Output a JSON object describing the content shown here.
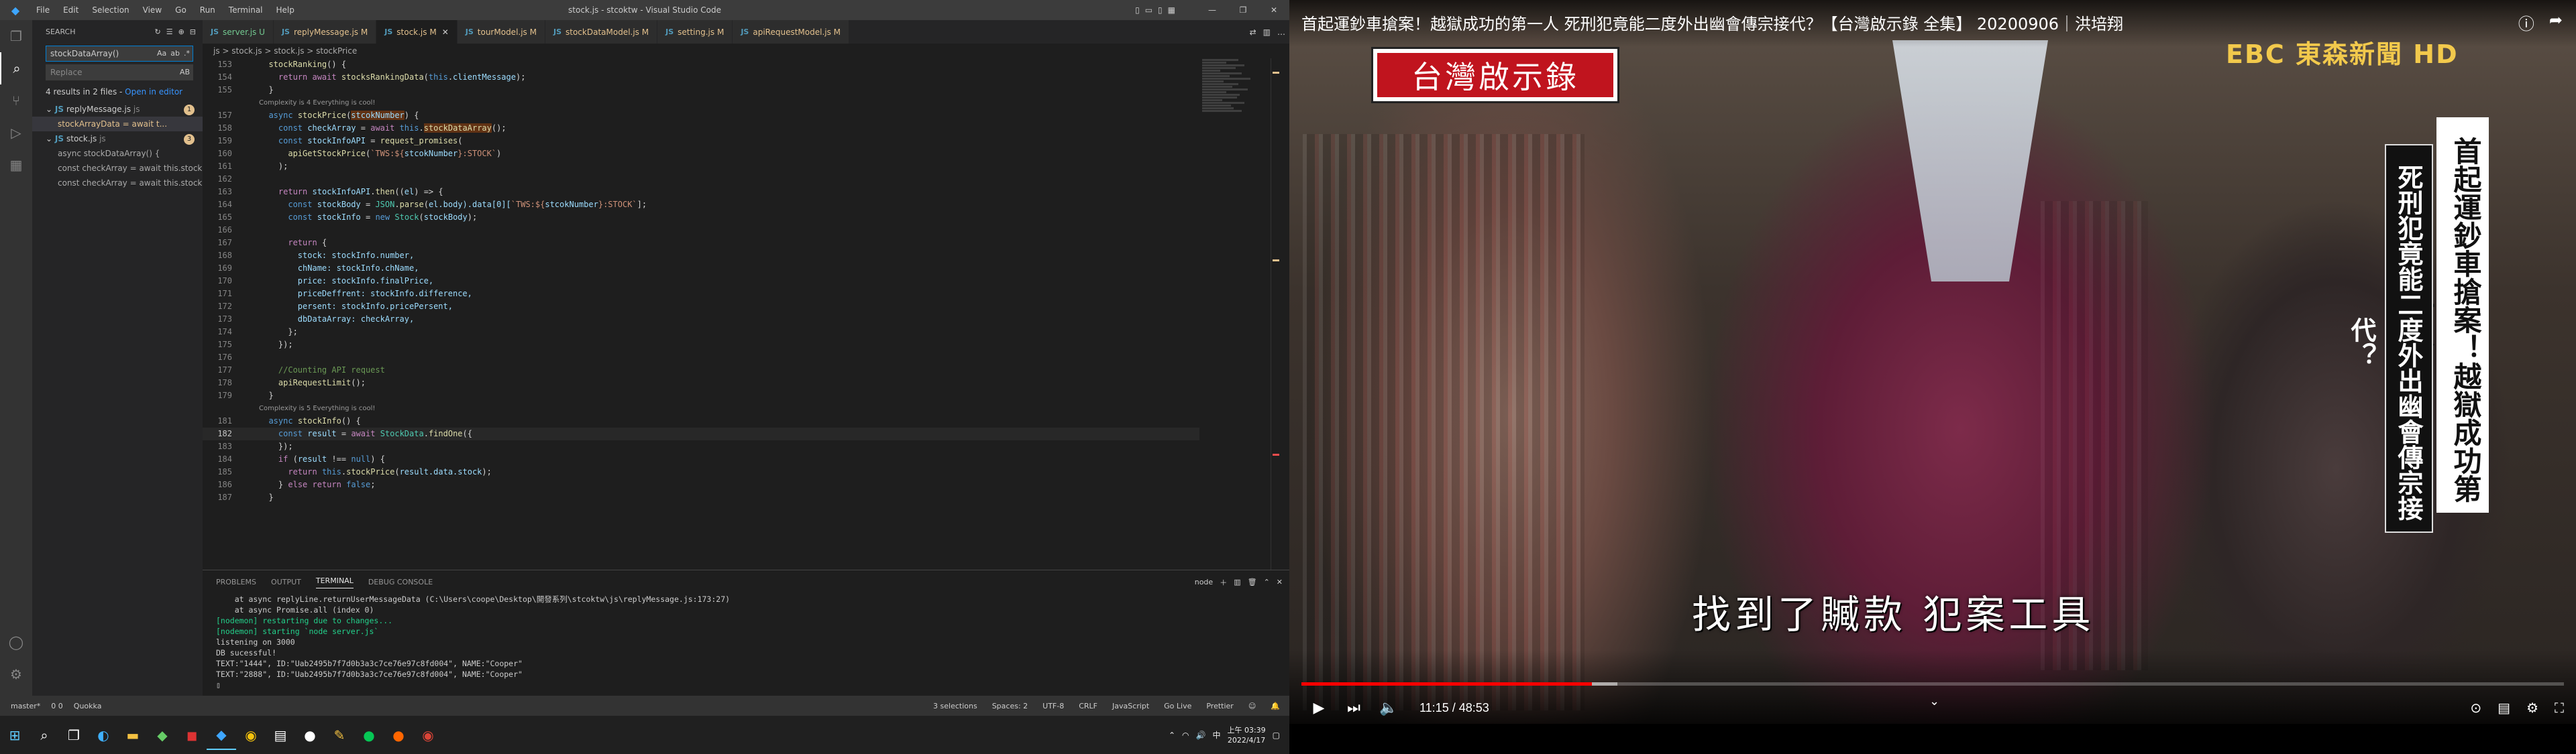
{
  "vscode": {
    "menu": [
      "File",
      "Edit",
      "Selection",
      "View",
      "Go",
      "Run",
      "Terminal",
      "Help"
    ],
    "window_title": "stock.js - stcoktw - Visual Studio Code",
    "search": {
      "header": "SEARCH",
      "query": "stockDataArray()",
      "replace_placeholder": "Replace",
      "summary": "4 results in 2 files - ",
      "open_in_editor": "Open in editor",
      "files": [
        {
          "name": "replyMessage.js",
          "path": "js",
          "count": "1",
          "matches": [
            "stockArrayData = await t..."
          ]
        },
        {
          "name": "stock.js",
          "path": "js",
          "count": "3",
          "matches": [
            "async stockDataArray() {",
            "const checkArray = await this.stock...",
            "const checkArray = await this.stock..."
          ]
        }
      ]
    },
    "tabs": [
      {
        "label": "server.js",
        "flag": "U"
      },
      {
        "label": "replyMessage.js",
        "flag": "M"
      },
      {
        "label": "stock.js",
        "flag": "M"
      },
      {
        "label": "tourModel.js",
        "flag": "M"
      },
      {
        "label": "stockDataModel.js",
        "flag": "M"
      },
      {
        "label": "setting.js",
        "flag": "M"
      },
      {
        "label": "apiRequestModel.js",
        "flag": "M"
      }
    ],
    "breadcrumb": "js > stock.js > stock.js > stockPrice",
    "code": {
      "l153": "153",
      "l154": "154",
      "l155": "155",
      "l157": "157",
      "l158": "158",
      "l159": "159",
      "l160": "160",
      "l161": "161",
      "l162": "162",
      "l163": "163",
      "l164": "164",
      "l165": "165",
      "l166": "166",
      "l167": "167",
      "l168": "168",
      "l169": "169",
      "l170": "170",
      "l171": "171",
      "l172": "172",
      "l173": "173",
      "l174": "174",
      "l175": "175",
      "l176": "176",
      "l177": "177",
      "l178": "178",
      "l179": "179",
      "l181": "181",
      "l182": "182",
      "l183": "183",
      "l184": "184",
      "l185": "185",
      "l186": "186",
      "l187": "187",
      "lens1": "Complexity is 4 Everything is cool!",
      "lens2": "Complexity is 5 Everything is cool!",
      "stockRanking": "stockRanking",
      "stocksRankingData": "stocksRankingData",
      "clientMessage": "clientMessage",
      "stockPrice": "stockPrice",
      "stcokNumber": "stcokNumber",
      "checkArray": "checkArray",
      "stockDataArray": "stockDataArray",
      "stockInfoAPI": "stockInfoAPI",
      "request_promises": "request_promises",
      "apiGetStockPrice": "apiGetStockPrice",
      "tws": "`TWS:${",
      "stock_suffix": "}:STOCK`",
      "then": "then",
      "el": "el",
      "stockBody": "stockBody",
      "JSON": "JSON",
      "parse": "parse",
      "body_data": "el.body).data[0][",
      "stockInfo": "stockInfo",
      "Stock": "Stock",
      "ret_stock": "stock: stockInfo.number,",
      "ret_chName": "chName: stockInfo.chName,",
      "ret_price": "price: stockInfo.finalPrice,",
      "ret_diff": "priceDeffrent: stockInfo.difference,",
      "ret_persent": "persent: stockInfo.pricePersent,",
      "ret_db": "dbDataArray: checkArray,",
      "comment": "//Counting API request",
      "apiRequestLimit": "apiRequestLimit",
      "stockInfoFn": "stockInfo",
      "result": "result",
      "StockData": "StockData",
      "findOne": "findOne",
      "result_stock": "result.data.stock",
      "false": "false",
      "null": "null"
    },
    "panel": {
      "tabs": [
        "PROBLEMS",
        "OUTPUT",
        "TERMINAL",
        "DEBUG CONSOLE"
      ],
      "shell": "node",
      "lines": [
        "    at async replyLine.returnUserMessageData (C:\\Users\\coope\\Desktop\\開發系列\\stcoktw\\js\\replyMessage.js:173:27)",
        "    at async Promise.all (index 0)",
        "[nodemon] restarting due to changes...",
        "[nodemon] starting `node server.js`",
        "listening on 3000",
        "DB sucessful!",
        "TEXT:\"1444\", ID:\"Uab2495b7f7d0b3a3c7ce76e97c8fd004\", NAME:\"Cooper\"",
        "TEXT:\"2888\", ID:\"Uab2495b7f7d0b3a3c7ce76e97c8fd004\", NAME:\"Cooper\""
      ]
    },
    "status": {
      "branch": "master*",
      "errors": "0  0",
      "quokka": "Quokka",
      "selections": "3 selections",
      "spaces": "Spaces: 2",
      "encoding": "UTF-8",
      "eol": "CRLF",
      "lang": "JavaScript",
      "golive": "Go Live",
      "prettier": "Prettier"
    }
  },
  "taskbar": {
    "time": "上午 03:39",
    "date": "2022/4/17"
  },
  "youtube": {
    "title": "首起運鈔車搶案！越獄成功的第一人 死刑犯竟能二度外出幽會傳宗接代？【台灣啟示錄 全集】 20200906｜洪培翔",
    "show_logo": "台灣啟示錄",
    "channel_logo": "EBC 東森新聞 HD",
    "banner_right": "首起運鈔車搶案！越獄成功第一人",
    "banner_left": "死刑犯竟能二度外出幽會傳宗接代？",
    "subtitle": "找到了贓款 犯案工具",
    "time": "11:15 / 48:53",
    "progress_played": 0.23,
    "progress_loaded": 0.25
  }
}
